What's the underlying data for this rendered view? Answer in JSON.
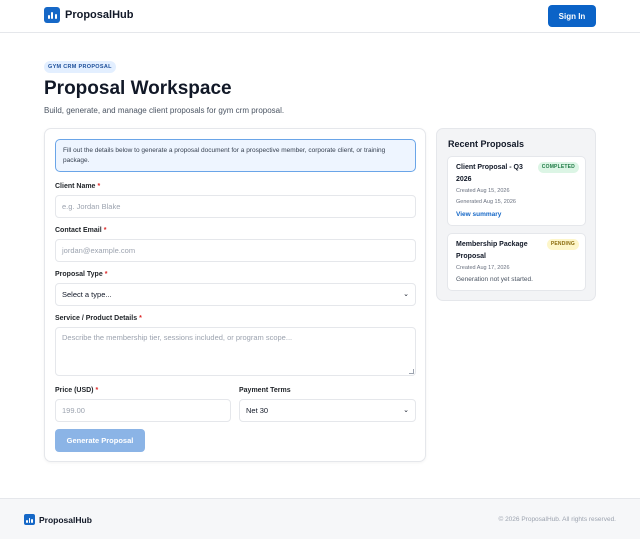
{
  "brand": {
    "name": "ProposalHub",
    "color": "#1668c7"
  },
  "header": {
    "signin_label": "Sign In"
  },
  "page": {
    "badge": "GYM CRM PROPOSAL",
    "title": "Proposal Workspace",
    "subtitle": "Build, generate, and manage client proposals for gym crm proposal."
  },
  "form": {
    "info": "Fill out the details below to generate a proposal document for a prospective member, corporate client, or training package.",
    "client_name": {
      "label": "Client Name",
      "required": "*",
      "placeholder": "e.g. Jordan Blake"
    },
    "contact_email": {
      "label": "Contact Email",
      "required": "*",
      "placeholder": "jordan@example.com"
    },
    "proposal_type": {
      "label": "Proposal Type",
      "required": "*",
      "value": "Select a type..."
    },
    "service_details": {
      "label": "Service / Product Details",
      "required": "*",
      "placeholder": "Describe the membership tier, sessions included, or program scope..."
    },
    "price": {
      "label": "Price (USD)",
      "required": "*",
      "placeholder": "199.00"
    },
    "payment_terms": {
      "label": "Payment Terms",
      "value": "Net 30"
    },
    "submit_label": "Generate Proposal"
  },
  "recent": {
    "title": "Recent Proposals",
    "items": [
      {
        "title": "Client Proposal - Q3 2026",
        "status": "COMPLETED",
        "created": "Created Aug 15, 2026",
        "generated": "Generated Aug 15, 2026",
        "action": "View summary"
      },
      {
        "title": "Membership Package Proposal",
        "status": "PENDING",
        "created": "Created Aug 17, 2026",
        "note": "Generation not yet started."
      }
    ]
  },
  "footer": {
    "brand": "ProposalHub",
    "copyright": "© 2026 ProposalHub. All rights reserved."
  },
  "icons": {
    "logo": "bar-chart-icon",
    "select": "chevron-down-icon"
  }
}
